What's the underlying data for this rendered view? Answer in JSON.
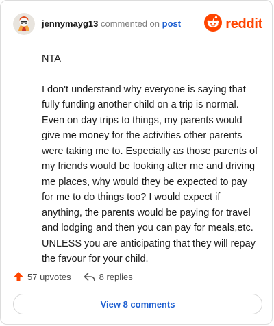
{
  "header": {
    "username": "jennymayg13",
    "action_text": "commented on",
    "post_link": "post",
    "brand": "reddit"
  },
  "comment": {
    "paragraphs": [
      "NTA",
      "I don't understand why everyone is saying that fully funding another child on a trip is normal. Even on day trips to things, my parents would give me money for the activities other parents were taking me to. Especially as those parents of my friends would be looking after me and driving me places, why would they be expected to pay for me to do things too? I would expect if anything, the parents would be paying for travel and lodging and then you can pay for meals,etc. UNLESS you are anticipating that they will repay the favour for your child."
    ]
  },
  "stats": {
    "upvotes": "57 upvotes",
    "replies": "8 replies"
  },
  "footer": {
    "view_comments": "View 8 comments"
  },
  "colors": {
    "brand": "#ff4500",
    "link": "#1d5fd1"
  },
  "icons": {
    "avatar": "avatar",
    "logo": "reddit-snoo-icon",
    "upvote": "upvote-arrow-icon",
    "reply": "reply-arrow-icon"
  }
}
